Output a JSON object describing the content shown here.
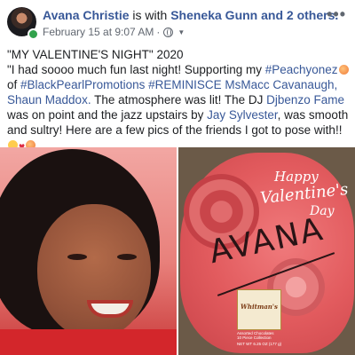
{
  "post": {
    "author": "Avana Christie",
    "with_text": " is with ",
    "tagged": "Sheneka Gunn",
    "and_others": " and 2 others.",
    "timestamp": "February 15 at 9:07 AM",
    "separator": "·",
    "privacy_icon": "globe-icon",
    "more_label": "•••",
    "body": {
      "title": "\"MY VALENTINE'S NIGHT\" 2020",
      "p1": "\"I had soooo much fun last night! Supporting my ",
      "tag_peach": "#Peachyonez",
      "of": " of",
      "tag_blackpearl": "#BlackPearlPromotions",
      "space1": " ",
      "tag_reminisce": "#REMINISCE",
      "mentions": " MsMacc Cavanaugh, Shaun Maddox.",
      "p2": " The atmosphere was lit! The DJ ",
      "dj": "Djbenzo Fame",
      "p3": " was on point and the jazz upstairs by ",
      "jazz": "Jay Sylvester",
      "p4": ", was smooth and sultry! Here are a few pics of the friends I got to pose with!!"
    }
  },
  "photos": {
    "right": {
      "happy": "Happy",
      "valentines": "Valentine's",
      "day": "Day",
      "signature": "AVANA",
      "brand": "Whitman's",
      "assorted": "Assorted Chocolates",
      "count": "10 Piece Collection",
      "net_wt": "NET WT 6.25 OZ (177 g)"
    }
  },
  "colors": {
    "link": "#385898",
    "online": "#31a24c"
  }
}
